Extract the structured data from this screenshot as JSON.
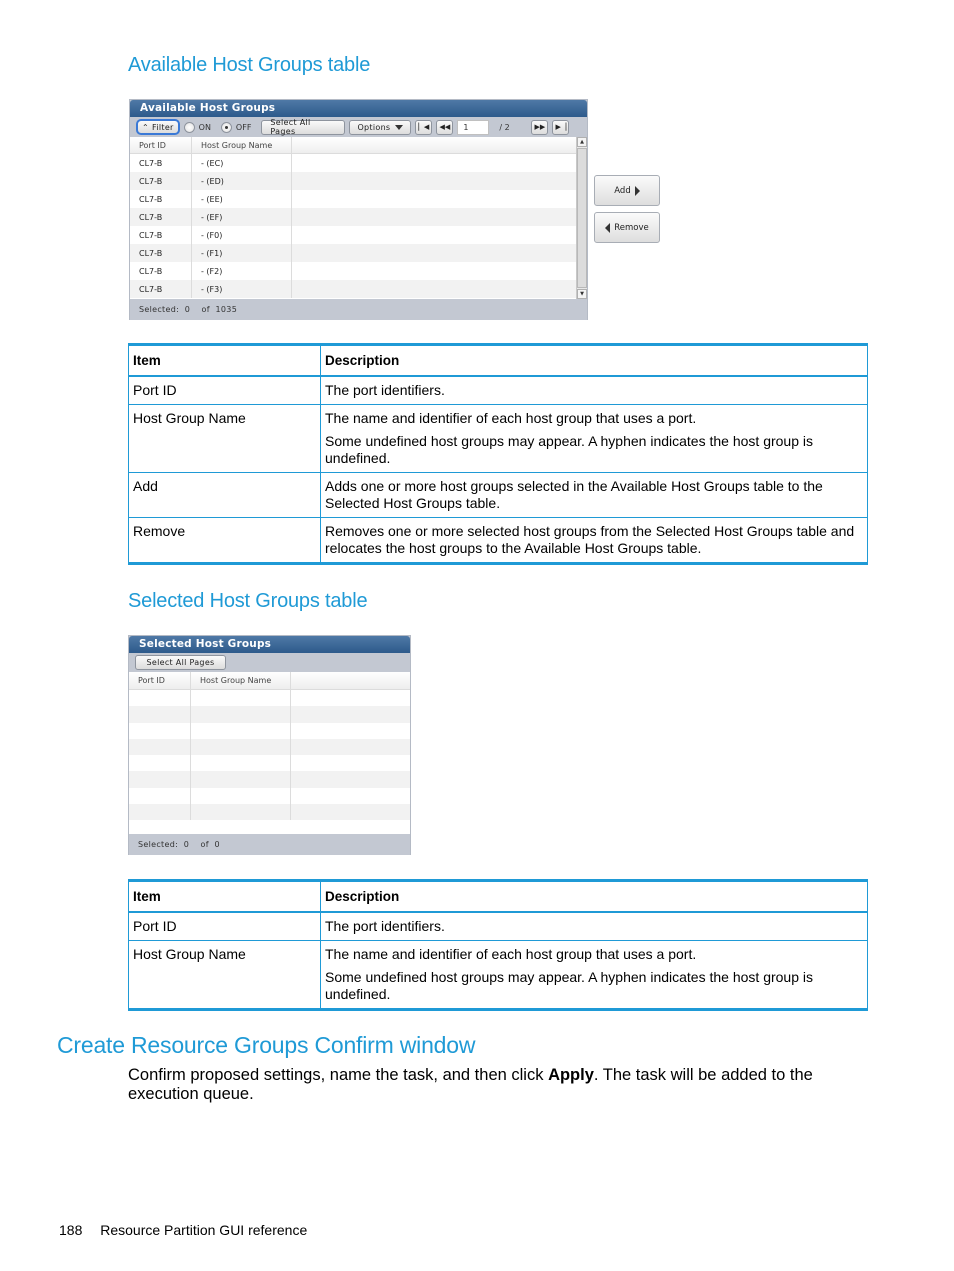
{
  "sections": {
    "available_heading": "Available Host Groups table",
    "selected_heading": "Selected Host Groups table",
    "confirm_heading": "Create Resource Groups Confirm window"
  },
  "available_panel": {
    "title": "Available Host Groups",
    "toolbar": {
      "filter_label": "Filter",
      "filter_icon": "double-chevron-up-icon",
      "radio_on_label": "ON",
      "radio_off_label": "OFF",
      "radio_selected": "OFF",
      "select_all_label": "Select All Pages",
      "options_label": "Options",
      "page_current": "1",
      "page_total_label": "/ 2",
      "first_icon": "first-page-icon",
      "prev_icon": "previous-page-icon",
      "next_icon": "next-page-icon",
      "last_icon": "last-page-icon"
    },
    "columns": [
      "Port ID",
      "Host Group Name"
    ],
    "rows": [
      {
        "port_id": "CL7-B",
        "host_group": "- (EC)"
      },
      {
        "port_id": "CL7-B",
        "host_group": "- (ED)"
      },
      {
        "port_id": "CL7-B",
        "host_group": "- (EE)"
      },
      {
        "port_id": "CL7-B",
        "host_group": "- (EF)"
      },
      {
        "port_id": "CL7-B",
        "host_group": "- (F0)"
      },
      {
        "port_id": "CL7-B",
        "host_group": "- (F1)"
      },
      {
        "port_id": "CL7-B",
        "host_group": "- (F2)"
      },
      {
        "port_id": "CL7-B",
        "host_group": "- (F3)"
      }
    ],
    "status": "Selected:  0    of  1035"
  },
  "side_buttons": {
    "add_label": "Add",
    "remove_label": "Remove"
  },
  "available_table": {
    "headers": [
      "Item",
      "Description"
    ],
    "rows": [
      {
        "item": "Port ID",
        "desc": [
          "The port identifiers."
        ]
      },
      {
        "item": "Host Group Name",
        "desc": [
          "The name and identifier of each host group that uses a port.",
          "Some undefined host groups may appear. A hyphen indicates the host group is undefined."
        ]
      },
      {
        "item": "Add",
        "desc": [
          "Adds one or more host groups selected in the Available Host Groups table to the Selected Host Groups table."
        ]
      },
      {
        "item": "Remove",
        "desc": [
          "Removes one or more selected host groups from the Selected Host Groups table and relocates the host groups to the Available Host Groups table."
        ]
      }
    ]
  },
  "selected_panel": {
    "title": "Selected Host Groups",
    "select_all_label": "Select All Pages",
    "columns": [
      "Port ID",
      "Host Group Name"
    ],
    "status": "Selected:  0    of  0"
  },
  "selected_table": {
    "headers": [
      "Item",
      "Description"
    ],
    "rows": [
      {
        "item": "Port ID",
        "desc": [
          "The port identifiers."
        ]
      },
      {
        "item": "Host Group Name",
        "desc": [
          "The name and identifier of each host group that uses a port.",
          "Some undefined host groups may appear. A hyphen indicates the host group is undefined."
        ]
      }
    ]
  },
  "confirm": {
    "text_before": "Confirm proposed settings, name the task, and then click ",
    "text_bold": "Apply",
    "text_after": ". The task will be added to the execution queue."
  },
  "footer": {
    "page_number": "188",
    "section_title": "Resource Partition GUI reference"
  }
}
